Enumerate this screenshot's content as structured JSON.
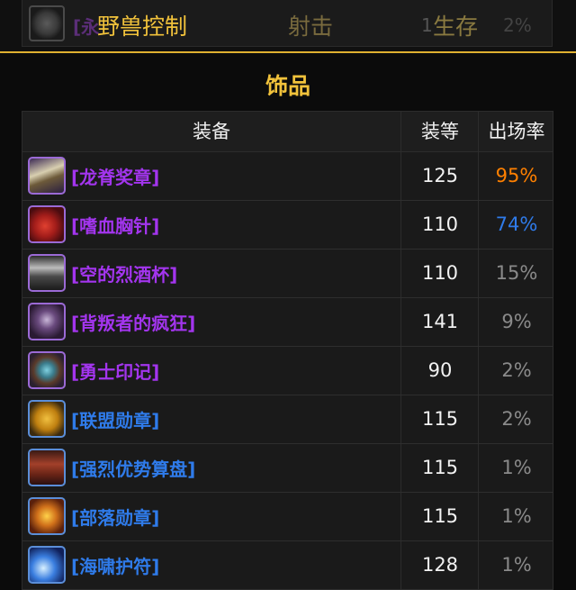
{
  "tabs": [
    {
      "label": "野兽控制",
      "active": true
    },
    {
      "label": "射击",
      "active": false
    },
    {
      "label": "生存",
      "active": false
    }
  ],
  "ghost_row": {
    "name": "[永",
    "ilvl": "1",
    "pct": "2%"
  },
  "section_title": "饰品",
  "table": {
    "headers": {
      "gear": "装备",
      "ilvl": "装等",
      "rate": "出场率"
    },
    "rows": [
      {
        "name": "[龙脊奖章]",
        "ilvl": "125",
        "rate": "95%",
        "name_color": "#a335ee",
        "rate_color": "#ff8000",
        "icon": "spine-icon"
      },
      {
        "name": "[嗜血胸针]",
        "ilvl": "110",
        "rate": "74%",
        "name_color": "#a335ee",
        "rate_color": "#2f7bea",
        "icon": "red-brooch-icon"
      },
      {
        "name": "[空的烈酒杯]",
        "ilvl": "110",
        "rate": "15%",
        "name_color": "#a335ee",
        "rate_color": "#8a8a8a",
        "icon": "empty-cup-icon"
      },
      {
        "name": "[背叛者的疯狂]",
        "ilvl": "141",
        "rate": "9%",
        "name_color": "#a335ee",
        "rate_color": "#8a8a8a",
        "icon": "skull-face-icon"
      },
      {
        "name": "[勇士印记]",
        "ilvl": "90",
        "rate": "2%",
        "name_color": "#a335ee",
        "rate_color": "#8a8a8a",
        "icon": "gem-badge-icon"
      },
      {
        "name": "[联盟勋章]",
        "ilvl": "115",
        "rate": "2%",
        "name_color": "#2f7bea",
        "rate_color": "#8a8a8a",
        "icon": "gold-medal-icon"
      },
      {
        "name": "[强烈优势算盘]",
        "ilvl": "115",
        "rate": "1%",
        "name_color": "#2f7bea",
        "rate_color": "#8a8a8a",
        "icon": "chest-icon"
      },
      {
        "name": "[部落勋章]",
        "ilvl": "115",
        "rate": "1%",
        "name_color": "#2f7bea",
        "rate_color": "#8a8a8a",
        "icon": "horde-medal-icon"
      },
      {
        "name": "[海啸护符]",
        "ilvl": "128",
        "rate": "1%",
        "name_color": "#2f7bea",
        "rate_color": "#8a8a8a",
        "icon": "wave-charm-icon"
      }
    ]
  }
}
